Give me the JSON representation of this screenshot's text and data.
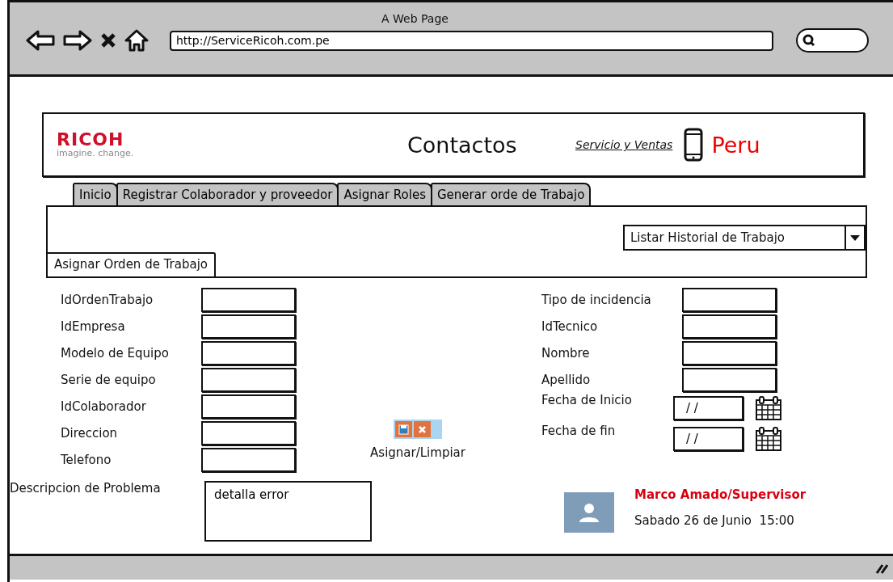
{
  "browser": {
    "title": "A Web Page",
    "url": "http://ServiceRicoh.com.pe"
  },
  "header": {
    "logo": "RICOH",
    "tagline": "imagine. change.",
    "title": "Contactos",
    "link": "Servicio y Ventas",
    "country": "Peru"
  },
  "tabs": [
    {
      "label": "Inicio",
      "selected": false
    },
    {
      "label": "Registrar Colaborador y proveedor",
      "selected": false
    },
    {
      "label": "Asignar Roles",
      "selected": false
    },
    {
      "label": "Generar orde de Trabajo",
      "selected": false
    }
  ],
  "dropdown": {
    "value": "Listar Historial de Trabajo"
  },
  "subtab": {
    "label": "Asignar Orden de Trabajo"
  },
  "left_fields": [
    {
      "label": "IdOrdenTrabajo"
    },
    {
      "label": "IdEmpresa"
    },
    {
      "label": "Modelo de Equipo"
    },
    {
      "label": "Serie de equipo"
    },
    {
      "label": "IdColaborador"
    },
    {
      "label": "Direccion"
    },
    {
      "label": "Telefono"
    }
  ],
  "actions": {
    "caption": "Asignar/Limpiar"
  },
  "right_fields": [
    {
      "label": "Tipo de incidencia",
      "kind": "text"
    },
    {
      "label": "IdTecnico",
      "kind": "text"
    },
    {
      "label": "Nombre",
      "kind": "text"
    },
    {
      "label": "Apellido",
      "kind": "text"
    },
    {
      "label": "Fecha de Inicio",
      "kind": "date",
      "value": "/ /"
    },
    {
      "label": "Fecha de fin",
      "kind": "date",
      "value": "/ /"
    }
  ],
  "description": {
    "label": "Descripcion de Problema",
    "value": "detalla error"
  },
  "user": {
    "name": "Marco Amado/Supervisor",
    "datetime": "Sabado 26 de Junio  15:00"
  }
}
